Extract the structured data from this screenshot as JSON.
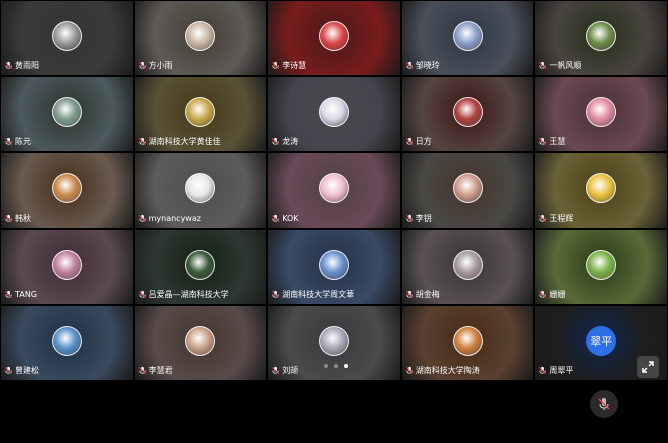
{
  "participants": [
    {
      "name": "黄雨阳",
      "bg": "#3a3a3a",
      "av": "#9a9a9a"
    },
    {
      "name": "方小雨",
      "bg": "#5e5a56",
      "av": "#c9b7a0"
    },
    {
      "name": "李诗慧",
      "bg": "#7a1c1c",
      "av": "#d64a4a"
    },
    {
      "name": "邹晓玲",
      "bg": "#4a4f5a",
      "av": "#8aa0c8"
    },
    {
      "name": "一帆风顺",
      "bg": "#4a4440",
      "av": "#6d8c4a"
    },
    {
      "name": "陈元",
      "bg": "#4d5a5e",
      "av": "#7e9a8a"
    },
    {
      "name": "湖南科技大学黄佳佳",
      "bg": "#5a5236",
      "av": "#c9a74a"
    },
    {
      "name": "龙涛",
      "bg": "#45434c",
      "av": "#d8d8e8"
    },
    {
      "name": "日方",
      "bg": "#554540",
      "av": "#b04040"
    },
    {
      "name": "王慧",
      "bg": "#6a4a52",
      "av": "#e08aa0"
    },
    {
      "name": "韩秋",
      "bg": "#6a5a50",
      "av": "#c9884a"
    },
    {
      "name": "mynancywaz",
      "bg": "#5e5c5a",
      "av": "#e8e8e8"
    },
    {
      "name": "KOK",
      "bg": "#6a4a58",
      "av": "#f0c0d0"
    },
    {
      "name": "李钥",
      "bg": "#4a4844",
      "av": "#d09a8a"
    },
    {
      "name": "王程辉",
      "bg": "#6a6238",
      "av": "#e8c040"
    },
    {
      "name": "TANG",
      "bg": "#5a4a50",
      "av": "#c080a0"
    },
    {
      "name": "吕爱晶—湖南科技大学",
      "bg": "#2e3832",
      "av": "#3a5a3a"
    },
    {
      "name": "湖南科技大学周文華",
      "bg": "#3a4a66",
      "av": "#6a90d0"
    },
    {
      "name": "胡金梅",
      "bg": "#5a5252",
      "av": "#a89aa0"
    },
    {
      "name": "姗姗",
      "bg": "#5a6a38",
      "av": "#7ab048"
    },
    {
      "name": "曾建松",
      "bg": "#3a4a5e",
      "av": "#5a90c8"
    },
    {
      "name": "李慧君",
      "bg": "#5a4a4a",
      "av": "#c8a088"
    },
    {
      "name": "刘颉",
      "bg": "#4c4a4a",
      "av": "#a8a8b8"
    },
    {
      "name": "湖南科技大学陶涛",
      "bg": "#5a4030",
      "av": "#d08040"
    },
    {
      "name": "周翠平",
      "bg": "#1e1e1e",
      "av": "#2f6fe6",
      "text": "翠平"
    }
  ],
  "pager": {
    "pages": 3,
    "current": 3
  }
}
